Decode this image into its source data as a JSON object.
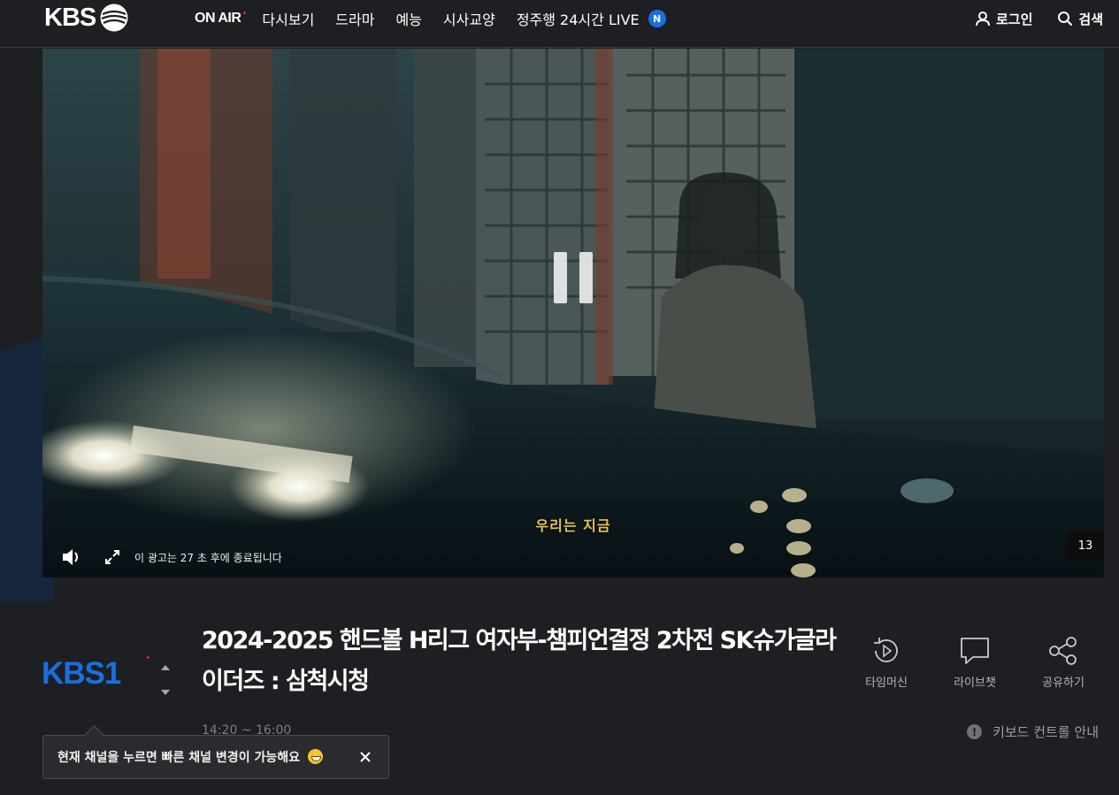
{
  "header": {
    "logo": "KBS",
    "nav": [
      {
        "label": "ON AIR"
      },
      {
        "label": "다시보기"
      },
      {
        "label": "드라마"
      },
      {
        "label": "예능"
      },
      {
        "label": "시사교양"
      },
      {
        "label": "정주행 24시간 LIVE",
        "badge": "N"
      }
    ],
    "login_label": "로그인",
    "search_label": "검색"
  },
  "player": {
    "subtitle": "우리는 지금",
    "ad_notice": "이 광고는 27 초 후에 종료됩니다",
    "skip_count": "13"
  },
  "program": {
    "channel": "KBS1",
    "title": "2024-2025 핸드볼 H리그 여자부-챔피언결정 2차전 SK슈가글라이더즈 : 삼척시청",
    "time": "14:20 ~ 16:00"
  },
  "actions": [
    {
      "label": "타임머신",
      "icon": "timemachine-icon"
    },
    {
      "label": "라이브챗",
      "icon": "chat-icon"
    },
    {
      "label": "공유하기",
      "icon": "share-icon"
    }
  ],
  "keyboard_guide": "키보드 컨트롤 안내",
  "tooltip": {
    "text": "현재 채널을 누르면 빠른 채널 변경이 가능해요"
  },
  "colors": {
    "background": "#1e1f22",
    "accent_blue": "#1a6ee0",
    "subtitle_yellow": "#e8c44a",
    "onair_red": "#e0302b"
  }
}
